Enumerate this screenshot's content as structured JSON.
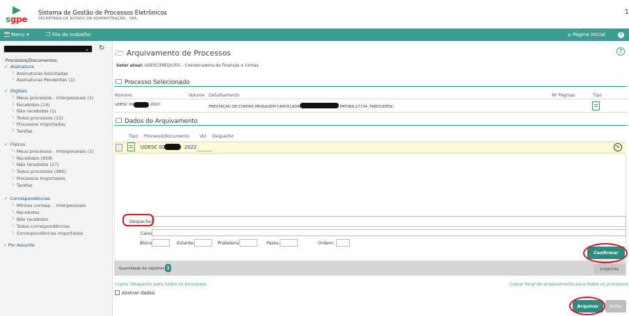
{
  "header": {
    "logo_s": "s",
    "logo_gpe": "gpe",
    "system_name": "Sistema de Gestão de Processos Eletrônicos",
    "secretariat": "SECRETARIA DE ESTADO DA ADMINISTRAÇÃO - SEA",
    "top_right_char": "1"
  },
  "navbar": {
    "menu_label": "Menu",
    "queue_label": "Fila de trabalho",
    "home_label": "Página inicial",
    "help_char": "?"
  },
  "sidebar": {
    "root": "Processos/Documentos",
    "sections": [
      {
        "title": "Assinatura",
        "items": [
          "Assinaturas Solicitadas",
          "Assinaturas Pendentes (1)"
        ]
      },
      {
        "title": "Digitais",
        "items": [
          "Meus processos - Interpessoais (1)",
          "Recebidos (14)",
          "Não recebidos (1)",
          "Todos processos (15)",
          "Processos importados",
          "Tarefas"
        ]
      },
      {
        "title": "Físicos",
        "items": [
          "Meus processos - Interpessoais (1)",
          "Recebidos (958)",
          "Não recebidos (27)",
          "Todos processos (985)",
          "Processos importados",
          "Tarefas"
        ]
      },
      {
        "title": "Correspondências",
        "items": [
          "Minhas corresp. - Interpessoais",
          "Recebidos",
          "Não recebidos",
          "Todas correspondências",
          "Correspondências importadas"
        ]
      }
    ],
    "por_assunto": "Por Assunto"
  },
  "main": {
    "title": "Arquivamento de Processos",
    "setor_label": "Setor atual:",
    "setor_value": "UDESC/FAED/CFIC - Coordenadoria de Finanças e Contas",
    "processo_selecionado": {
      "heading": "Processo Selecionado",
      "columns": {
        "numero": "Número",
        "volume": "Volume",
        "detalhamento": "Detalhamento",
        "paginas": "Nº Páginas",
        "tipo": "Tipo"
      },
      "row": {
        "numero_prefix": "UDESC 000",
        "numero_suffix": "2022",
        "detalhamento_prefix": "PRESTAÇÃO DE CONTAS PASSAGEM CANCELADA -",
        "detalhamento_suffix": "FATURA 27734. FAED/UDESC."
      }
    },
    "dados_arquivamento": {
      "heading": "Dados do Arquivamento",
      "columns": {
        "tipo": "Tipo",
        "processo": "Processo/Documento",
        "vol": "Vol.",
        "despacho": "Despacho"
      },
      "row": {
        "processo_prefix": "UDESC 000",
        "processo_suffix": "2022"
      }
    },
    "form": {
      "despacho": "Despacho:",
      "caixa": "Caixa:",
      "bloco": "Bloco:",
      "estante": "Estante:",
      "prateleira": "Prateleira:",
      "pasta": "Pasta:",
      "ordem": "Ordem:",
      "confirmar": "Confirmar"
    },
    "quantidade_label": "Quantidade de registros:",
    "quantidade_value": "1",
    "legenda": "Legenda",
    "copy_despacho": "Copiar Despacho para todos os processos",
    "copy_local": "Copiar local de arquivamento para todos os processos",
    "assinar_dados": "Assinar dados",
    "arquivar": "Arquivar",
    "voltar": "Voltar"
  },
  "colors": {
    "teal": "#3c9d8f",
    "button_green": "#2e8c7e",
    "highlight_ring": "#e0102a",
    "row_yellow": "#fdfcd8"
  }
}
